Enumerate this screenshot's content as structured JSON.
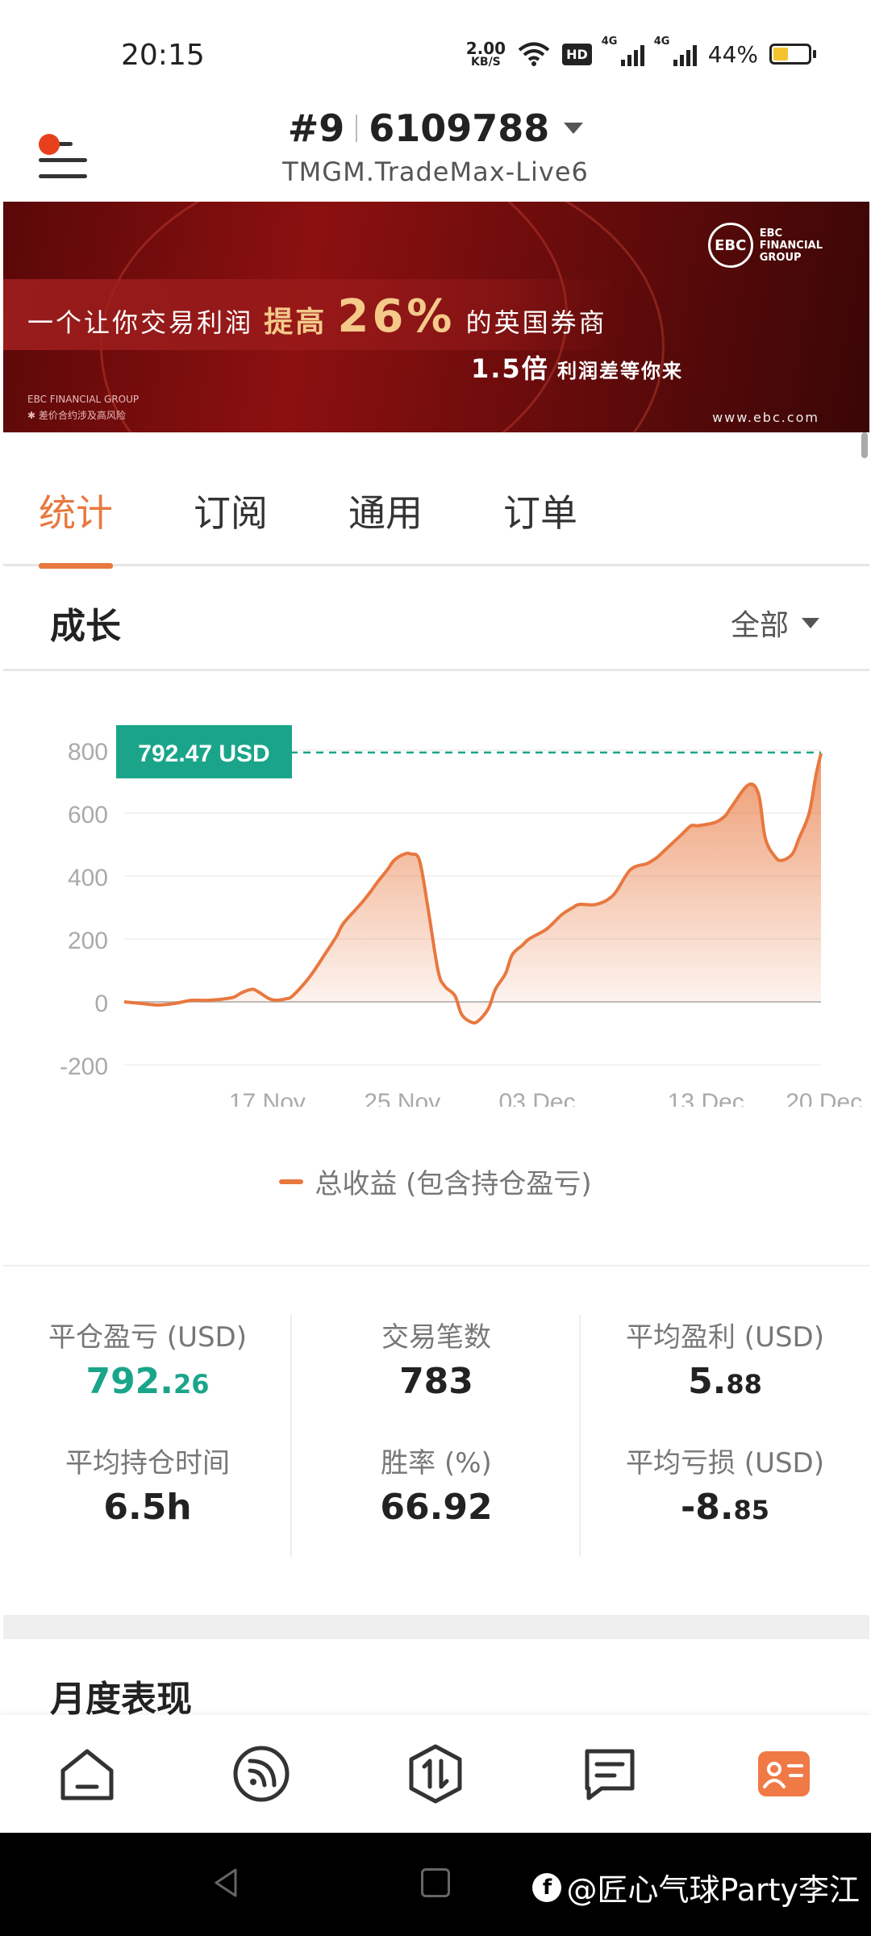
{
  "status_bar": {
    "time": "20:15",
    "net_speed_value": "2.00",
    "net_speed_unit": "KB/S",
    "hd_badge": "HD",
    "signal_tag_1": "4G",
    "signal_tag_2": "4G",
    "battery": "44%",
    "battery_level": 0.44
  },
  "header": {
    "account_rank": "#9",
    "account_number": "6109788",
    "server": "TMGM.TradeMax-Live6"
  },
  "banner": {
    "headline_pre": "一个让你交易利润",
    "headline_bold": "提高",
    "headline_big": "26%",
    "headline_post": "的英国券商",
    "sub_big": "1.5倍",
    "sub_text": "利润差等你来",
    "logo_mark": "EBC",
    "logo_text_1": "EBC",
    "logo_text_2": "FINANCIAL",
    "logo_text_3": "GROUP",
    "foot_1": "EBC FINANCIAL GROUP",
    "foot_2": "✱ 差价合约涉及高风险",
    "url": "www.ebc.com"
  },
  "tabs": [
    {
      "label": "统计",
      "active": true
    },
    {
      "label": "订阅",
      "active": false
    },
    {
      "label": "通用",
      "active": false
    },
    {
      "label": "订单",
      "active": false
    }
  ],
  "growth": {
    "title": "成长",
    "filter": "全部"
  },
  "chart_data": {
    "type": "area",
    "y_ticks": [
      "800",
      "600",
      "400",
      "200",
      "0",
      "-200"
    ],
    "ylim": [
      -200,
      800
    ],
    "x_ticks": [
      "17 Nov",
      "25 Nov",
      "03 Dec",
      "13 Dec",
      "20 Dec"
    ],
    "x_tick_positions": [
      8,
      16,
      24,
      34,
      41
    ],
    "current_value_label": "792.47 USD",
    "current_value": 792.47,
    "accent_line_color": "#e8783f",
    "marker_color": "#1aa58a",
    "series": [
      {
        "name": "总收益 (包含持仓盈亏)",
        "x": [
          0,
          1,
          2,
          3,
          4,
          5,
          6,
          6.5,
          7,
          7.6,
          8,
          8.6,
          9,
          9.6,
          10,
          11,
          12,
          12.6,
          13,
          14,
          14.6,
          15,
          15.6,
          16,
          16.6,
          17,
          17.5,
          18,
          18.6,
          19,
          19.6,
          20,
          20.6,
          21,
          21.6,
          22,
          22.6,
          23,
          23.6,
          24,
          25,
          25.6,
          26,
          26.6,
          27,
          28,
          29,
          30,
          31,
          31.6,
          32,
          33,
          33.6,
          34,
          35,
          35.6,
          36,
          37,
          37.6,
          38,
          38.6,
          39,
          39.6,
          40,
          40.6,
          41,
          41.3
        ],
        "values": [
          0,
          -5,
          -10,
          -5,
          5,
          5,
          10,
          15,
          30,
          40,
          30,
          10,
          5,
          10,
          20,
          80,
          160,
          210,
          250,
          310,
          350,
          380,
          420,
          450,
          470,
          470,
          450,
          300,
          100,
          50,
          20,
          -40,
          -65,
          -60,
          -20,
          40,
          90,
          150,
          180,
          200,
          230,
          260,
          280,
          300,
          310,
          310,
          340,
          420,
          440,
          460,
          480,
          530,
          560,
          560,
          570,
          590,
          620,
          690,
          660,
          520,
          460,
          450,
          470,
          520,
          600,
          720,
          790
        ]
      }
    ],
    "legend": "总收益 (包含持仓盈亏)",
    "grid": true,
    "legend_position": "bottom"
  },
  "stats": {
    "closed_pl_label": "平仓盈亏 (USD)",
    "closed_pl_int": "792.",
    "closed_pl_dec": "26",
    "trades_label": "交易笔数",
    "trades_value": "783",
    "avg_profit_label": "平均盈利 (USD)",
    "avg_profit_int": "5.",
    "avg_profit_dec": "88",
    "avg_hold_label": "平均持仓时间",
    "avg_hold_value": "6.5h",
    "win_rate_label": "胜率 (%)",
    "win_rate_value": "66.92",
    "avg_loss_label": "平均亏损 (USD)",
    "avg_loss_int": "-8.",
    "avg_loss_dec": "85"
  },
  "monthly": {
    "title": "月度表现"
  },
  "bottom_nav": [
    {
      "icon": "home-icon",
      "active": false
    },
    {
      "icon": "signal-feed-icon",
      "active": false
    },
    {
      "icon": "trade-swap-icon",
      "active": false
    },
    {
      "icon": "message-icon",
      "active": false
    },
    {
      "icon": "profile-card-icon",
      "active": true
    }
  ],
  "watermark": {
    "fb": "f",
    "text": "@匠心气球Party李江"
  }
}
